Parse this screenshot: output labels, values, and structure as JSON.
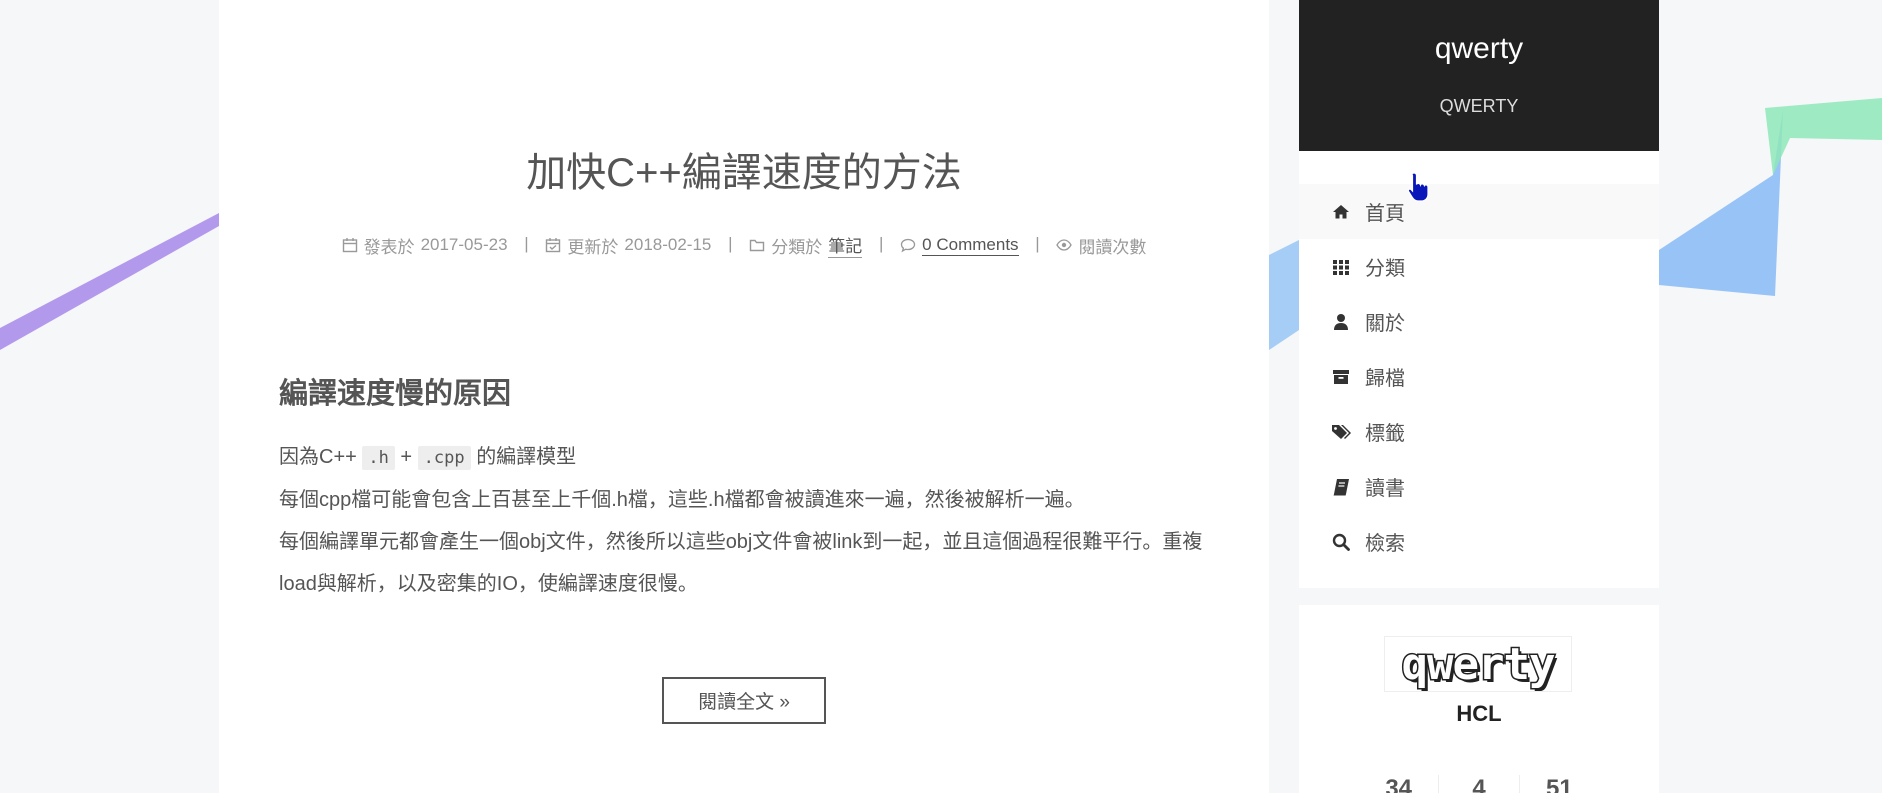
{
  "post": {
    "title": "加快C++編譯速度的方法",
    "meta": {
      "posted_label": "發表於",
      "posted_date": "2017-05-23",
      "updated_label": "更新於",
      "updated_date": "2018-02-15",
      "category_label": "分類於",
      "category": "筆記",
      "comments": "0 Comments",
      "views_label": "閱讀次數",
      "separator": "|"
    },
    "heading": "編譯速度慢的原因",
    "p1_prefix": "因為C++",
    "p1_code1": ".h",
    "p1_plus": "+",
    "p1_code2": ".cpp",
    "p1_suffix": "的編譯模型",
    "p2": "每個cpp檔可能會包含上百甚至上千個.h檔，這些.h檔都會被讀進來一遍，然後被解析一遍。",
    "p3": "每個編譯單元都會產生一個obj文件，然後所以這些obj文件會被link到一起，並且這個過程很難平行。重複load與解析，以及密集的IO，使編譯速度很慢。",
    "read_more": "閱讀全文 »"
  },
  "site": {
    "title": "qwerty",
    "subtitle": "QWERTY"
  },
  "menu": [
    {
      "label": "首頁",
      "icon": "home-icon",
      "active": true
    },
    {
      "label": "分類",
      "icon": "th-icon"
    },
    {
      "label": "關於",
      "icon": "user-icon"
    },
    {
      "label": "歸檔",
      "icon": "archive-icon"
    },
    {
      "label": "標籤",
      "icon": "tags-icon"
    },
    {
      "label": "讀書",
      "icon": "book-icon"
    },
    {
      "label": "檢索",
      "icon": "search-icon"
    }
  ],
  "profile": {
    "logo_text": "qwerty",
    "author": "HCL",
    "stats": [
      "34",
      "4",
      "51"
    ]
  },
  "colors": {
    "header_bg": "#222222",
    "text": "#555555",
    "meta": "#999999"
  }
}
